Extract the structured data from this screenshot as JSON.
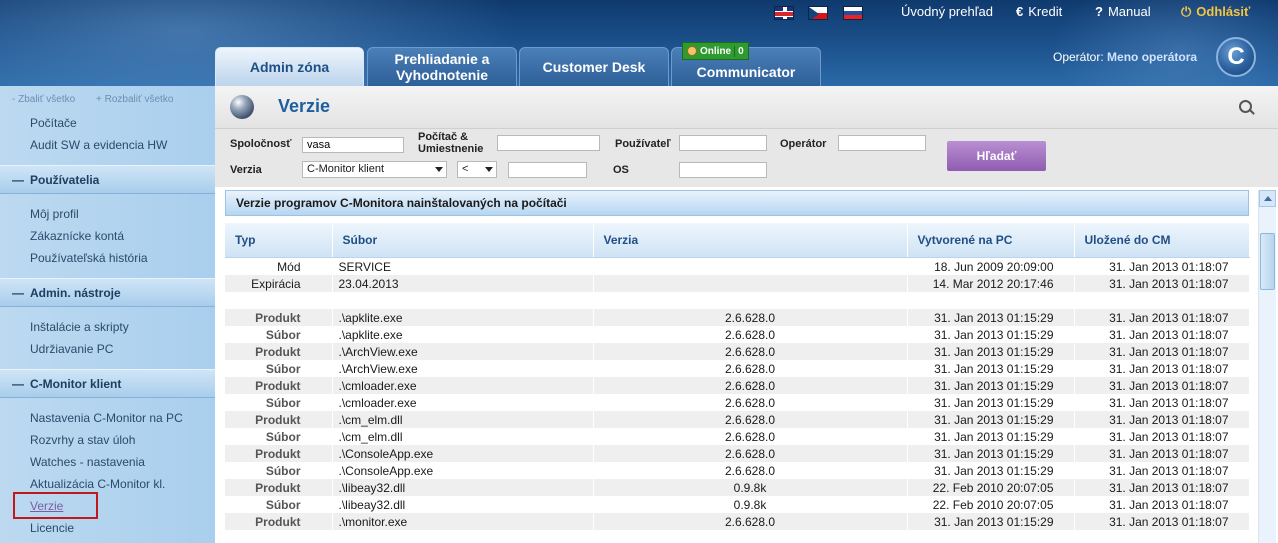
{
  "header": {
    "lang_flags": [
      "flag-en-icon",
      "flag-cz-icon",
      "flag-sk-icon"
    ],
    "links": {
      "overview": "Úvodný prehľad",
      "credit": "Kredit",
      "manual": "Manual",
      "logout": "Odhlásiť"
    },
    "operator_label": "Operátor:",
    "operator_name": "Meno operátora",
    "logo_letter": "C",
    "tabs": {
      "admin": "Admin zóna",
      "review_line1": "Prehliadanie a",
      "review_line2": "Vyhodnotenie",
      "customer": "Customer Desk",
      "communicator": "Communicator"
    },
    "online_badge": {
      "label": "Online",
      "count": "0"
    }
  },
  "sidebar": {
    "collapse_all": "- Zbaliť všetko",
    "expand_all": "+ Rozbaliť všetko",
    "items_top": [
      "Počítače",
      "Audit SW a evidencia HW"
    ],
    "sections": [
      {
        "title": "Používatelia",
        "items": [
          "Môj profil",
          "Zákaznícke kontá",
          "Používateľská história"
        ]
      },
      {
        "title": "Admin. nástroje",
        "items": [
          "Inštalácie a skripty",
          "Udržiavanie PC"
        ]
      },
      {
        "title": "C-Monitor klient",
        "items": [
          "Nastavenia C-Monitor na PC",
          "Rozvrhy a stav úloh",
          "Watches - nastavenia",
          "Aktualizácia C-Monitor kl.",
          "Verzie",
          "Licencie"
        ]
      }
    ]
  },
  "page": {
    "title": "Verzie",
    "filter": {
      "company_label": "Spoločnosť",
      "company_value": "vasa",
      "computer_label_1": "Počítač &",
      "computer_label_2": "Umiestnenie",
      "computer_value": "",
      "user_label": "Používateľ",
      "user_value": "",
      "operator_label": "Operátor",
      "operator_value": "",
      "version_label": "Verzia",
      "version_select": "C-Monitor klient",
      "compare_select": "<",
      "version_value": "",
      "os_label": "OS",
      "os_value": "",
      "search_button": "Hľadať"
    },
    "section_title": "Verzie programov C-Monitora nainštalovaných na počítači",
    "table": {
      "columns": [
        "Typ",
        "Súbor",
        "Verzia",
        "Vytvorené na PC",
        "Uložené do CM"
      ],
      "rows": [
        [
          "Mód",
          "SERVICE",
          "",
          "18. Jun 2009 20:09:00",
          "31. Jan 2013 01:18:07"
        ],
        [
          "Expirácia",
          "23.04.2013",
          "",
          "14. Mar 2012 20:17:46",
          "31. Jan 2013 01:18:07"
        ],
        [
          "",
          "",
          "",
          "",
          ""
        ],
        [
          "Produkt",
          ".\\apklite.exe",
          "2.6.628.0",
          "31. Jan 2013 01:15:29",
          "31. Jan 2013 01:18:07"
        ],
        [
          "Súbor",
          ".\\apklite.exe",
          "2.6.628.0",
          "31. Jan 2013 01:15:29",
          "31. Jan 2013 01:18:07"
        ],
        [
          "Produkt",
          ".\\ArchView.exe",
          "2.6.628.0",
          "31. Jan 2013 01:15:29",
          "31. Jan 2013 01:18:07"
        ],
        [
          "Súbor",
          ".\\ArchView.exe",
          "2.6.628.0",
          "31. Jan 2013 01:15:29",
          "31. Jan 2013 01:18:07"
        ],
        [
          "Produkt",
          ".\\cmloader.exe",
          "2.6.628.0",
          "31. Jan 2013 01:15:29",
          "31. Jan 2013 01:18:07"
        ],
        [
          "Súbor",
          ".\\cmloader.exe",
          "2.6.628.0",
          "31. Jan 2013 01:15:29",
          "31. Jan 2013 01:18:07"
        ],
        [
          "Produkt",
          ".\\cm_elm.dll",
          "2.6.628.0",
          "31. Jan 2013 01:15:29",
          "31. Jan 2013 01:18:07"
        ],
        [
          "Súbor",
          ".\\cm_elm.dll",
          "2.6.628.0",
          "31. Jan 2013 01:15:29",
          "31. Jan 2013 01:18:07"
        ],
        [
          "Produkt",
          ".\\ConsoleApp.exe",
          "2.6.628.0",
          "31. Jan 2013 01:15:29",
          "31. Jan 2013 01:18:07"
        ],
        [
          "Súbor",
          ".\\ConsoleApp.exe",
          "2.6.628.0",
          "31. Jan 2013 01:15:29",
          "31. Jan 2013 01:18:07"
        ],
        [
          "Produkt",
          ".\\libeay32.dll",
          "0.9.8k",
          "22. Feb 2010 20:07:05",
          "31. Jan 2013 01:18:07"
        ],
        [
          "Súbor",
          ".\\libeay32.dll",
          "0.9.8k",
          "22. Feb 2010 20:07:05",
          "31. Jan 2013 01:18:07"
        ],
        [
          "Produkt",
          ".\\monitor.exe",
          "2.6.628.0",
          "31. Jan 2013 01:15:29",
          "31. Jan 2013 01:18:07"
        ]
      ]
    }
  }
}
